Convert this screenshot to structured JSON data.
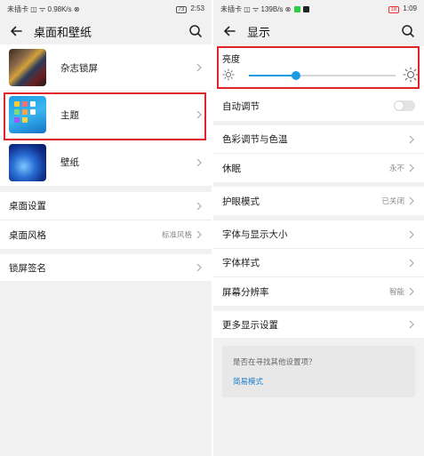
{
  "left": {
    "status": {
      "left": "未插卡 ◫ ᯤ 0.98K/s ⊗",
      "battery": "73",
      "time": "2:53"
    },
    "title": "桌面和壁纸",
    "media_items": [
      {
        "label": "杂志锁屏",
        "thumb": "magazine"
      },
      {
        "label": "主题",
        "thumb": "theme"
      },
      {
        "label": "壁纸",
        "thumb": "wallpaper"
      }
    ],
    "settings": [
      {
        "label": "桌面设置",
        "value": ""
      },
      {
        "label": "桌面风格",
        "value": "标准风格"
      }
    ],
    "lock_signature": {
      "label": "锁屏签名"
    }
  },
  "right": {
    "status": {
      "left": "未插卡 ◫ ᯤ 139B/s ⊗",
      "battery": "18",
      "time": "1:09"
    },
    "title": "显示",
    "brightness": {
      "label": "亮度",
      "level": 0.32
    },
    "auto_adjust": {
      "label": "自动调节",
      "on": false
    },
    "color_group": [
      {
        "label": "色彩调节与色温",
        "value": ""
      },
      {
        "label": "休眠",
        "value": "永不"
      }
    ],
    "eye_group": [
      {
        "label": "护眼模式",
        "value": "已关闭"
      }
    ],
    "font_group": [
      {
        "label": "字体与显示大小",
        "value": ""
      },
      {
        "label": "字体样式",
        "value": ""
      },
      {
        "label": "屏幕分辨率",
        "value": "智能"
      }
    ],
    "more": {
      "label": "更多显示设置"
    },
    "hint": {
      "question": "是否在寻找其他设置项？",
      "link": "简易模式"
    }
  },
  "colors": {
    "accent": "#1a9ce4",
    "highlight": "#e0222b",
    "link": "#1a7fc9",
    "background": "#f1f1f1"
  },
  "icons": {
    "back": "arrow-left-icon",
    "search": "search-icon",
    "chevron": "chevron-right-icon",
    "brightness_low": "sun-small-icon",
    "brightness_high": "sun-large-icon"
  }
}
